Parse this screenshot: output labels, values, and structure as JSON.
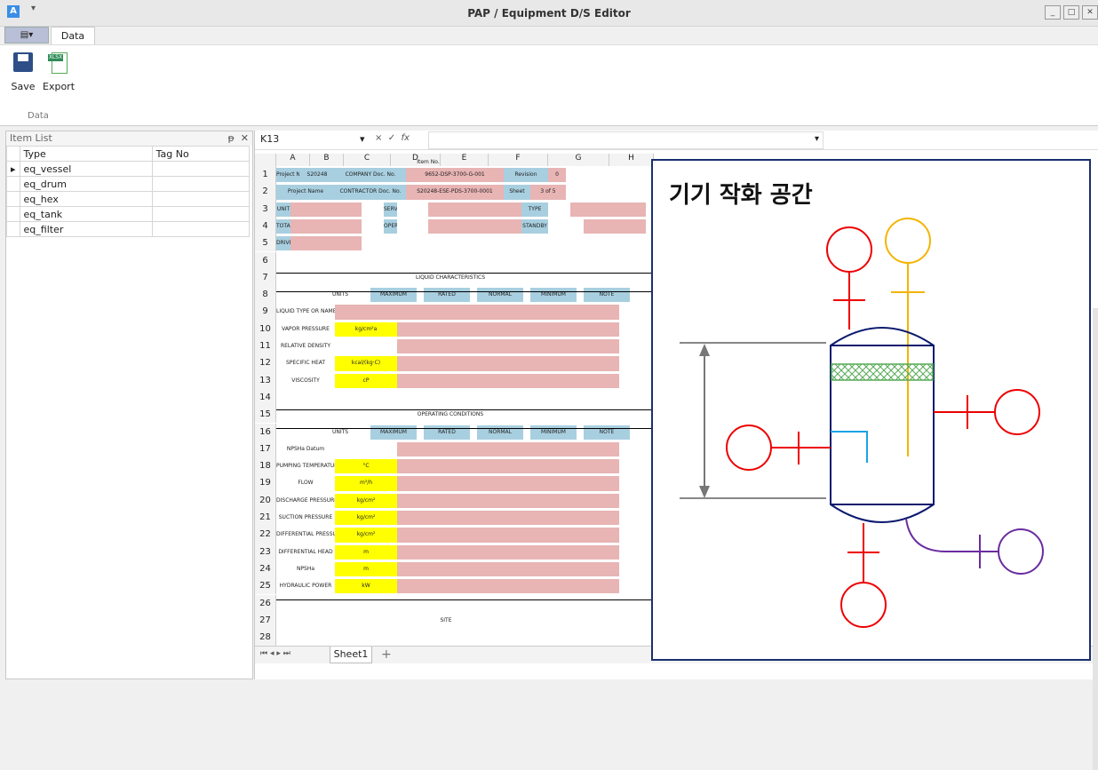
{
  "window": {
    "title": "PAP / Equipment D/S Editor",
    "quick_access": "▾"
  },
  "ribbon": {
    "tabs": [
      "Data"
    ],
    "save_label": "Save",
    "export_label": "Export",
    "export_tag": "XLSX",
    "group_label": "Data"
  },
  "item_list": {
    "title": "Item List",
    "pin": "ᵽ",
    "close": "✕",
    "columns": [
      "Type",
      "Tag No"
    ],
    "rows": [
      {
        "type": "eq_vessel",
        "tag": ""
      },
      {
        "type": "eq_drum",
        "tag": ""
      },
      {
        "type": "eq_hex",
        "tag": ""
      },
      {
        "type": "eq_tank",
        "tag": ""
      },
      {
        "type": "eq_filter",
        "tag": ""
      }
    ]
  },
  "formula_bar": {
    "cell_ref": "K13",
    "cancel": "×",
    "confirm": "✓",
    "fx": "fx"
  },
  "sheet": {
    "columns": [
      "A",
      "B",
      "C",
      "D",
      "E",
      "F",
      "G",
      "H"
    ],
    "rows": [
      "1",
      "2",
      "3",
      "4",
      "5",
      "6",
      "7",
      "8",
      "9",
      "10",
      "11",
      "12",
      "13",
      "14",
      "15",
      "16",
      "17",
      "18",
      "19",
      "20",
      "21",
      "22",
      "23",
      "24",
      "25",
      "26",
      "27",
      "28"
    ],
    "header": {
      "item_no": "Item No.",
      "project_no_lbl": "Project No.",
      "project_no": "S20248",
      "company_doc_lbl": "COMPANY Doc. No.",
      "company_doc": "9652-DSP-3700-G-001",
      "revision_lbl": "Revision",
      "revision": "0",
      "project_name_lbl": "Project Name",
      "contractor_doc_lbl": "CONTRACTOR Doc. No.",
      "contractor_doc": "S20248-ESE-PDS-3700-0001",
      "sheet_lbl": "Sheet",
      "sheet_val": "3 of 5",
      "unit": "UNIT",
      "service": "SERVICE",
      "type": "TYPE",
      "total_qty": "TOTAL QTY.",
      "operating": "OPERATING",
      "standby": "STANDBY",
      "driver_type": "DRIVER TYPE"
    },
    "liquid": {
      "title": "LIQUID CHARACTERISTICS",
      "cols": [
        "UNITS",
        "MAXIMUM",
        "RATED",
        "NORMAL",
        "MINIMUM",
        "NOTE"
      ],
      "rows": [
        {
          "label": "LIQUID TYPE OR NAME",
          "unit": ""
        },
        {
          "label": "VAPOR PRESSURE",
          "unit": "kg/cm²a"
        },
        {
          "label": "RELATIVE DENSITY",
          "unit": ""
        },
        {
          "label": "SPECIFIC HEAT",
          "unit": "kcal/(kg·C)"
        },
        {
          "label": "VISCOSITY",
          "unit": "cP"
        }
      ]
    },
    "operating": {
      "title": "OPERATING CONDITIONS",
      "cols": [
        "UNITS",
        "MAXIMUM",
        "RATED",
        "NORMAL",
        "MINIMUM",
        "NOTE"
      ],
      "rows": [
        {
          "label": "NPSHa Datum",
          "unit": ""
        },
        {
          "label": "PUMPING TEMPERATURE",
          "unit": "°C"
        },
        {
          "label": "FLOW",
          "unit": "m³/h"
        },
        {
          "label": "DISCHARGE PRESSURE",
          "unit": "kg/cm²"
        },
        {
          "label": "SUCTION PRESSURE",
          "unit": "kg/cm²"
        },
        {
          "label": "DIFFERENTIAL PRESSURE",
          "unit": "kg/cm²"
        },
        {
          "label": "DIFFERENTIAL HEAD",
          "unit": "m"
        },
        {
          "label": "NPSHa",
          "unit": "m"
        },
        {
          "label": "HYDRAULIC POWER",
          "unit": "kW"
        }
      ]
    },
    "row27": "SITE",
    "tab": "Sheet1",
    "add_tab": "+"
  },
  "overlay": {
    "title": "기기 작화 공간"
  }
}
